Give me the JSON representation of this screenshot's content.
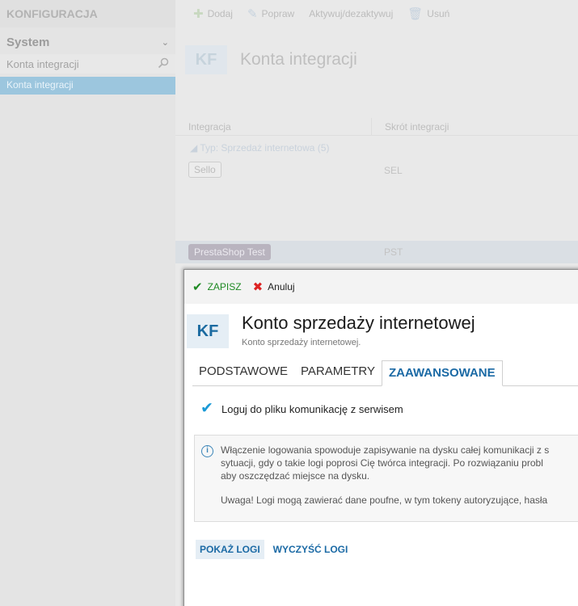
{
  "sidebar": {
    "header": "KONFIGURACJA",
    "section": "System",
    "search_item": "Konta integracji",
    "active_item": "Konta integracji"
  },
  "toolbar": {
    "add": "Dodaj",
    "edit": "Popraw",
    "toggle": "Aktywuj/dezaktywuj",
    "delete": "Usuń"
  },
  "main": {
    "badge": "KF",
    "title": "Konta integracji",
    "columns": [
      "Integracja",
      "Skrót integracji"
    ],
    "group": "Typ: Sprzedaż internetowa (5)",
    "rows": [
      {
        "name": "Sello",
        "code": "SEL"
      },
      {
        "name": "PrestaShop Test",
        "code": "PST"
      }
    ]
  },
  "modal": {
    "save": "ZAPISZ",
    "cancel": "Anuluj",
    "badge": "KF",
    "title": "Konto sprzedaży internetowej",
    "subtitle": "Konto sprzedaży internetowej.",
    "tabs": [
      "PODSTAWOWE",
      "PARAMETRY",
      "ZAAWANSOWANE"
    ],
    "active_tab": "ZAAWANSOWANE",
    "checkbox_label": "Loguj do pliku komunikację z serwisem",
    "checkbox_checked": true,
    "info_lines": [
      "Włączenie logowania spowoduje zapisywanie na dysku całej komunikacji z s",
      "sytuacji, gdy o takie logi poprosi Cię twórca integracji. Po rozwiązaniu probl",
      "aby oszczędzać miejsce na dysku."
    ],
    "info_warning": "Uwaga! Logi mogą zawierać dane poufne, w tym tokeny autoryzujące, hasła",
    "show_logs": "POKAŻ LOGI",
    "clear_logs": "WYCZYŚĆ LOGI"
  }
}
